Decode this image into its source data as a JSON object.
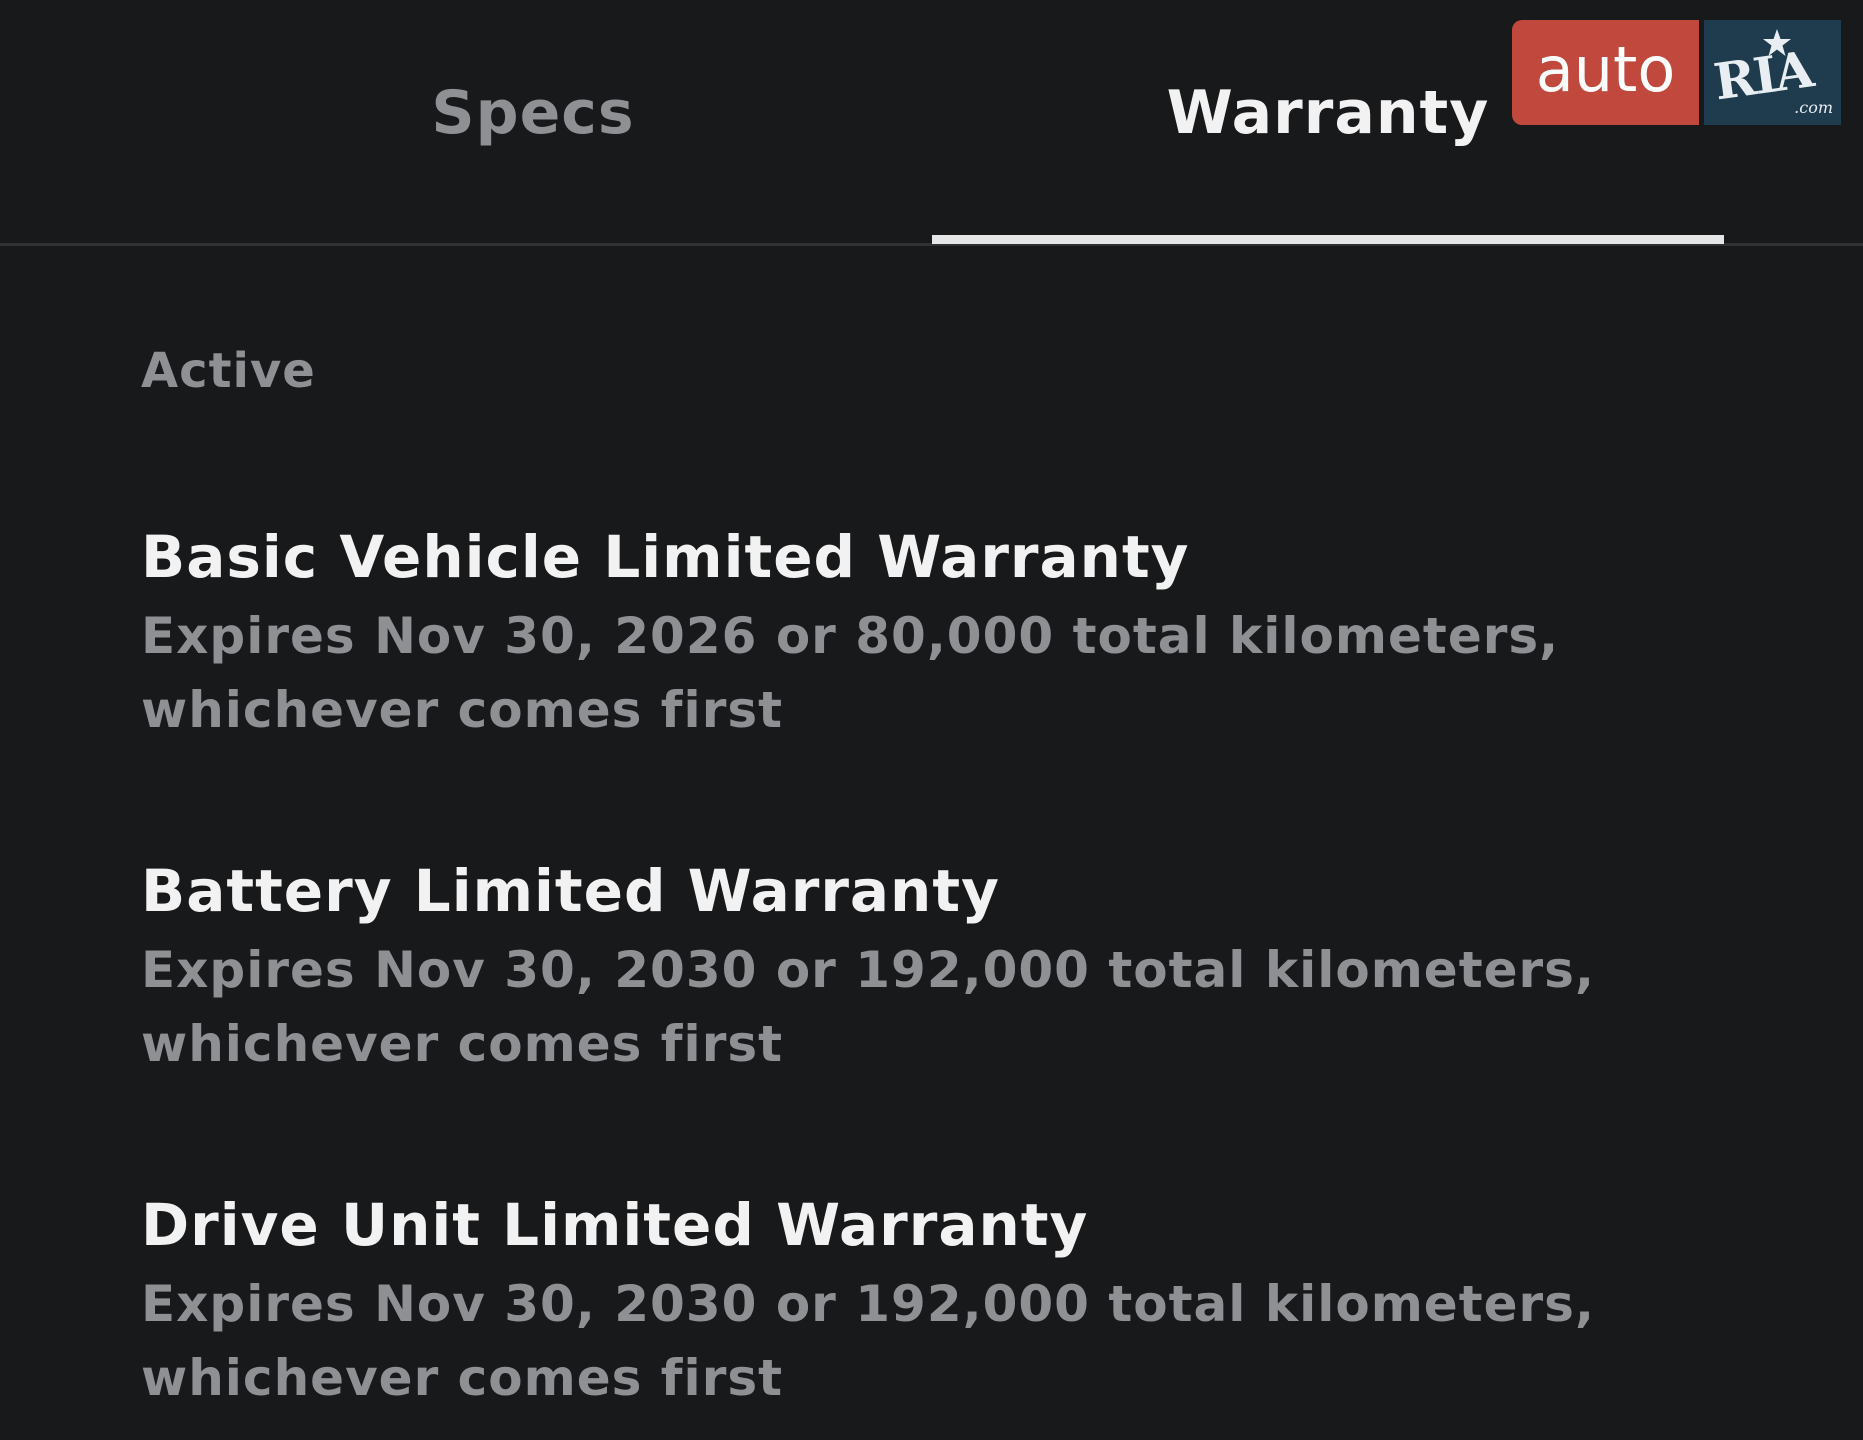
{
  "tabs": {
    "specs_label": "Specs",
    "warranty_label": "Warranty",
    "active_tab": "Warranty"
  },
  "watermark": {
    "left": "auto",
    "right": "RIA",
    "suffix": ".com"
  },
  "section": {
    "label": "Active"
  },
  "warranties": [
    {
      "title": "Basic Vehicle Limited Warranty",
      "line1": "Expires Nov 30, 2026 or 80,000 total kilometers,",
      "line2": "whichever comes first"
    },
    {
      "title": "Battery Limited Warranty",
      "line1": "Expires Nov 30, 2030 or 192,000 total kilometers,",
      "line2": "whichever comes first"
    },
    {
      "title": "Drive Unit Limited Warranty",
      "line1": "Expires Nov 30, 2030 or 192,000 total kilometers,",
      "line2": "whichever comes first"
    }
  ],
  "colors": {
    "background": "#18191b",
    "primary_text": "#f2f2f2",
    "secondary_text": "#8f9093",
    "tab_indicator": "#e6e6e6",
    "watermark_red": "#c0483c",
    "watermark_navy": "#1f3b4e"
  }
}
